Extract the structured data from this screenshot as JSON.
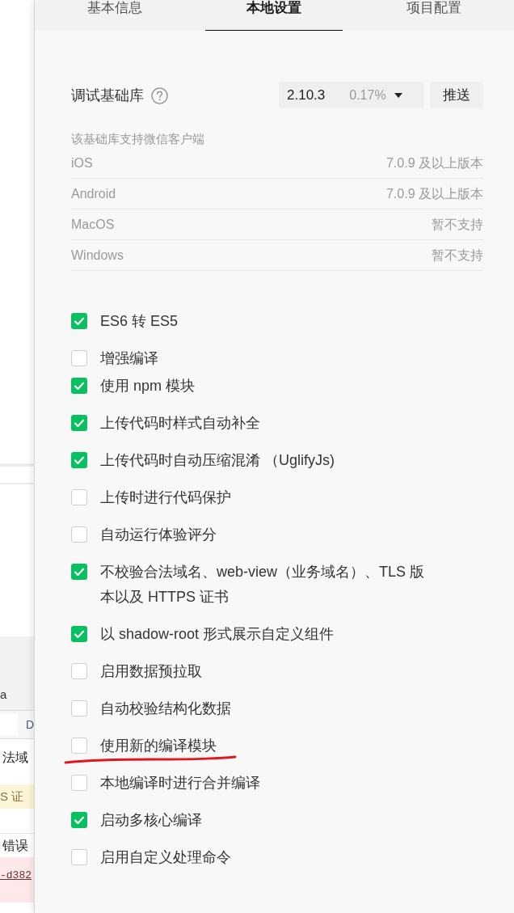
{
  "background_page": {
    "tab_text": "a",
    "button_text": "D",
    "row_text": "法域",
    "warning_text": "S 证",
    "header_text": "错误",
    "link_text": "-d382"
  },
  "tabs": [
    {
      "label": "基本信息",
      "selected": false
    },
    {
      "label": "本地设置",
      "selected": true
    },
    {
      "label": "项目配置",
      "selected": false
    }
  ],
  "debug_library": {
    "label": "调试基础库",
    "version": "2.10.3",
    "usage": "0.17%",
    "push_button": "推送"
  },
  "support": {
    "heading": "该基础库支持微信客户端",
    "rows": [
      {
        "platform": "iOS",
        "requirement": "7.0.9 及以上版本"
      },
      {
        "platform": "Android",
        "requirement": "7.0.9 及以上版本"
      },
      {
        "platform": "MacOS",
        "requirement": "暂不支持"
      },
      {
        "platform": "Windows",
        "requirement": "暂不支持"
      }
    ]
  },
  "options": [
    {
      "label": "ES6 转 ES5",
      "checked": true,
      "underlined": false
    },
    {
      "label": "增强编译",
      "checked": false,
      "underlined": false
    },
    {
      "label": "使用 npm 模块",
      "checked": true,
      "underlined": false
    },
    {
      "label": "上传代码时样式自动补全",
      "checked": true,
      "underlined": false
    },
    {
      "label": "上传代码时自动压缩混淆 （UglifyJs)",
      "checked": true,
      "underlined": false
    },
    {
      "label": "上传时进行代码保护",
      "checked": false,
      "underlined": false
    },
    {
      "label": "自动运行体验评分",
      "checked": false,
      "underlined": false
    },
    {
      "label": "不校验合法域名、web-view（业务域名）、TLS 版本以及 HTTPS 证书",
      "checked": true,
      "underlined": false
    },
    {
      "label": "以 shadow-root 形式展示自定义组件",
      "checked": true,
      "underlined": false
    },
    {
      "label": "启用数据预拉取",
      "checked": false,
      "underlined": false
    },
    {
      "label": "自动校验结构化数据",
      "checked": false,
      "underlined": false
    },
    {
      "label": "使用新的编译模块",
      "checked": false,
      "underlined": true
    },
    {
      "label": "本地编译时进行合并编译",
      "checked": false,
      "underlined": false
    },
    {
      "label": "启动多核心编译",
      "checked": true,
      "underlined": false
    },
    {
      "label": "启用自定义处理命令",
      "checked": false,
      "underlined": false
    }
  ]
}
